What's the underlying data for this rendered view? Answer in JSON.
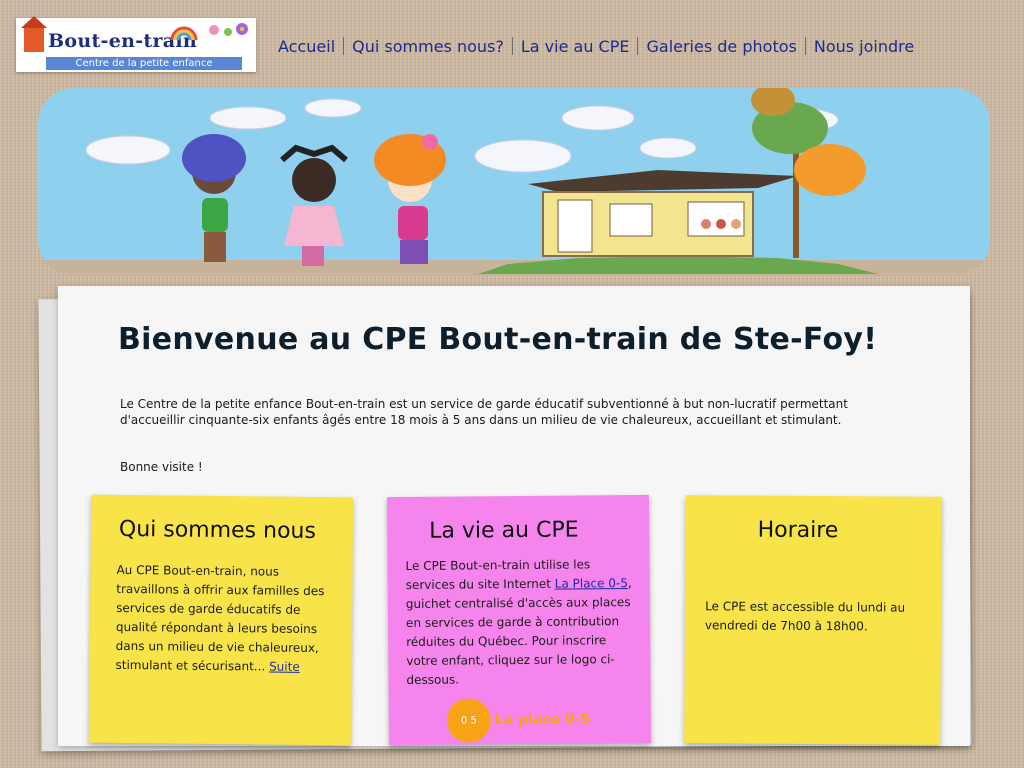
{
  "logo": {
    "brand": "Bout-en-train",
    "subtitle": "Centre de la petite enfance"
  },
  "nav": {
    "items": [
      {
        "label": "Accueil"
      },
      {
        "label": "Qui sommes nous?"
      },
      {
        "label": "La vie au CPE"
      },
      {
        "label": "Galeries de photos"
      },
      {
        "label": "Nous joindre"
      }
    ]
  },
  "main": {
    "title": "Bienvenue au CPE Bout-en-train de Ste-Foy!",
    "intro": "Le Centre de la petite enfance Bout-en-train est un service de garde éducatif subventionné à but non-lucratif permettant d'accueillir cinquante-six enfants âgés entre 18 mois à 5 ans dans un milieu de vie chaleureux, accueillant et stimulant.",
    "greeting": "Bonne visite !"
  },
  "notes": {
    "qui": {
      "title": "Qui sommes nous",
      "text": "Au CPE Bout-en-train, nous travaillons à offrir aux familles des services de garde éducatifs de qualité répondant à leurs besoins dans un milieu de vie chaleureux, stimulant et sécurisant...",
      "link": "Suite"
    },
    "vie": {
      "title": "La vie au CPE",
      "text_before": "Le CPE Bout-en-train utilise les services du site Internet",
      "link": "La Place 0-5",
      "text_after": ", guichet centralisé d'accès aux places en services de garde à contribution réduites du Québec. Pour inscrire votre enfant, cliquez sur le logo ci-dessous.",
      "logo_circle": "0 5",
      "logo_text": "La place 0-5"
    },
    "horaire": {
      "title": "Horaire",
      "text": "Le CPE est accessible du lundi au vendredi de 7h00 à 18h00."
    }
  },
  "colors": {
    "nav_text": "#1e2a8a",
    "note_yellow": "#f8e448",
    "note_pink": "#f585ec",
    "sky": "#8fd0ef"
  }
}
